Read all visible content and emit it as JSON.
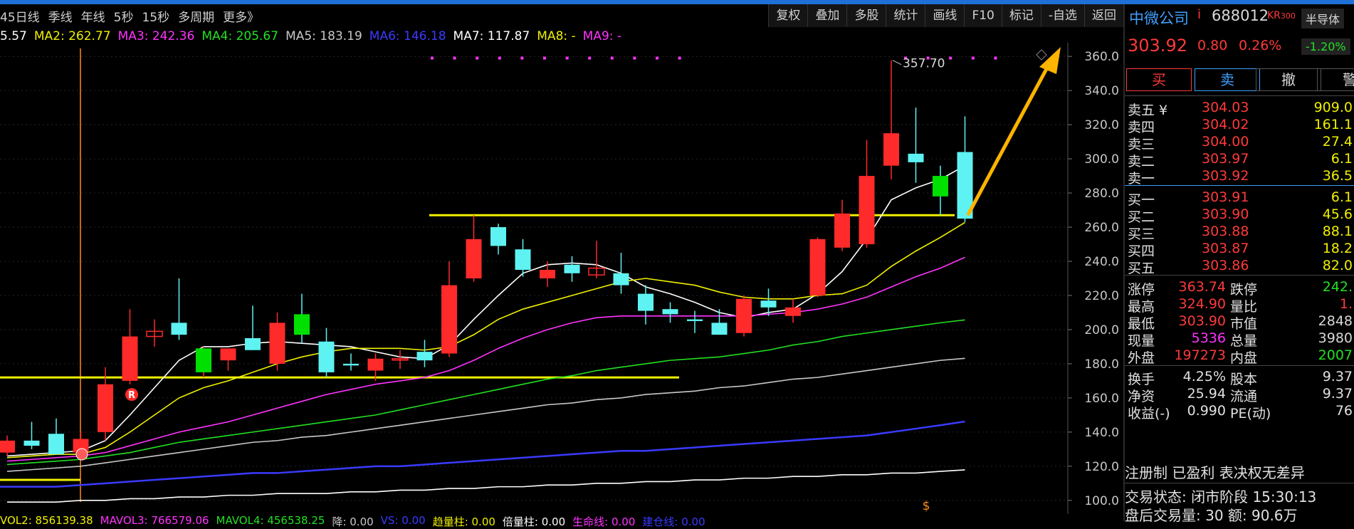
{
  "colors": {
    "up": "#ff2a2a",
    "down": "#00e000",
    "flat": "#ffffff",
    "accent": "#1e6fd6",
    "yellow": "#f0f000",
    "cyan": "#5ef2f2"
  },
  "period_bar": [
    "45日线",
    "季线",
    "年线",
    "5秒",
    "15秒",
    "多周期",
    "更多》"
  ],
  "toolbar": [
    "复权",
    "叠加",
    "多股",
    "统计",
    "画线",
    "F10",
    "标记",
    "-自选",
    "返回"
  ],
  "ma_legend": [
    {
      "label": "5.57",
      "color": "#ffffff"
    },
    {
      "label": "MA2: 262.77",
      "color": "#f0f000"
    },
    {
      "label": "MA3: 242.36",
      "color": "#ff33ff"
    },
    {
      "label": "MA4: 205.67",
      "color": "#22e022"
    },
    {
      "label": "MA5: 183.19",
      "color": "#c8c8c8"
    },
    {
      "label": "MA6: 146.18",
      "color": "#3a3aff"
    },
    {
      "label": "MA7: 117.87",
      "color": "#ffffff"
    },
    {
      "label": "MA8: -",
      "color": "#f0f000"
    },
    {
      "label": "MA9: -",
      "color": "#ff33ff"
    }
  ],
  "chart_data": {
    "type": "candlestick",
    "ylim": [
      92,
      368
    ],
    "y_ticks": [
      "360.0",
      "340.0",
      "320.0",
      "300.0",
      "280.0",
      "260.0",
      "240.0",
      "220.0",
      "200.0",
      "180.0",
      "160.0",
      "140.0",
      "120.0",
      "100.0"
    ],
    "candles": [
      {
        "o": 128,
        "h": 138,
        "l": 126,
        "c": 135
      },
      {
        "o": 135,
        "h": 146,
        "l": 130,
        "c": 132
      },
      {
        "o": 139,
        "h": 148,
        "l": 128,
        "c": 127
      },
      {
        "o": 128,
        "h": 140,
        "l": 127,
        "c": 136
      },
      {
        "o": 140,
        "h": 178,
        "l": 135,
        "c": 168
      },
      {
        "o": 170,
        "h": 212,
        "l": 168,
        "c": 196
      },
      {
        "o": 196,
        "h": 206,
        "l": 190,
        "c": 199
      },
      {
        "o": 204,
        "h": 230,
        "l": 194,
        "c": 197
      },
      {
        "o": 175,
        "h": 190,
        "l": 172,
        "c": 189
      },
      {
        "o": 182,
        "h": 189,
        "l": 176,
        "c": 189
      },
      {
        "o": 195,
        "h": 214,
        "l": 188,
        "c": 188
      },
      {
        "o": 180,
        "h": 210,
        "l": 176,
        "c": 204
      },
      {
        "o": 209,
        "h": 221,
        "l": 192,
        "c": 197
      },
      {
        "o": 193,
        "h": 201,
        "l": 172,
        "c": 175
      },
      {
        "o": 180,
        "h": 186,
        "l": 176,
        "c": 179
      },
      {
        "o": 176,
        "h": 186,
        "l": 170,
        "c": 183
      },
      {
        "o": 183,
        "h": 188,
        "l": 177,
        "c": 183
      },
      {
        "o": 187,
        "h": 194,
        "l": 178,
        "c": 182
      },
      {
        "o": 186,
        "h": 240,
        "l": 184,
        "c": 226
      },
      {
        "o": 230,
        "h": 267,
        "l": 228,
        "c": 253
      },
      {
        "o": 260,
        "h": 262,
        "l": 244,
        "c": 249
      },
      {
        "o": 247,
        "h": 253,
        "l": 231,
        "c": 235
      },
      {
        "o": 230,
        "h": 240,
        "l": 225,
        "c": 235
      },
      {
        "o": 238,
        "h": 243,
        "l": 228,
        "c": 233
      },
      {
        "o": 232,
        "h": 252,
        "l": 230,
        "c": 236
      },
      {
        "o": 233,
        "h": 245,
        "l": 221,
        "c": 226
      },
      {
        "o": 221,
        "h": 226,
        "l": 203,
        "c": 211
      },
      {
        "o": 212,
        "h": 216,
        "l": 204,
        "c": 209
      },
      {
        "o": 206,
        "h": 211,
        "l": 198,
        "c": 205
      },
      {
        "o": 204,
        "h": 212,
        "l": 197,
        "c": 197
      },
      {
        "o": 198,
        "h": 220,
        "l": 196,
        "c": 218
      },
      {
        "o": 217,
        "h": 224,
        "l": 208,
        "c": 213
      },
      {
        "o": 208,
        "h": 218,
        "l": 204,
        "c": 213
      },
      {
        "o": 220,
        "h": 254,
        "l": 219,
        "c": 253
      },
      {
        "o": 248,
        "h": 276,
        "l": 246,
        "c": 268
      },
      {
        "o": 250,
        "h": 311,
        "l": 248,
        "c": 290
      },
      {
        "o": 296,
        "h": 357.7,
        "l": 288,
        "c": 315
      },
      {
        "o": 303,
        "h": 330,
        "l": 286,
        "c": 298
      },
      {
        "o": 290,
        "h": 296,
        "l": 267,
        "c": 278
      },
      {
        "o": 304,
        "h": 324.9,
        "l": 263,
        "c": 265
      }
    ],
    "ma_lines": [
      {
        "name": "MA1",
        "color": "#ffffff",
        "values": [
          126,
          127,
          128,
          129,
          135,
          150,
          166,
          182,
          190,
          190,
          192,
          193,
          192,
          191,
          190,
          187,
          184,
          183,
          191,
          206,
          220,
          233,
          238,
          239,
          238,
          233,
          225,
          221,
          216,
          210,
          207,
          210,
          212,
          221,
          234,
          253,
          276,
          283,
          288,
          296
        ]
      },
      {
        "name": "MA2",
        "color": "#f0f000",
        "values": [
          125,
          126,
          127,
          127,
          131,
          140,
          150,
          160,
          166,
          170,
          175,
          180,
          184,
          187,
          189,
          189,
          189,
          188,
          190,
          197,
          206,
          212,
          216,
          220,
          224,
          228,
          230,
          228,
          226,
          222,
          219,
          218,
          218,
          220,
          221,
          226,
          237,
          246,
          254,
          262.77
        ]
      },
      {
        "name": "MA3",
        "color": "#ff33ff",
        "values": [
          123,
          124,
          125,
          126,
          128,
          132,
          136,
          140,
          143,
          146,
          150,
          154,
          158,
          162,
          165,
          168,
          170,
          172,
          176,
          182,
          189,
          195,
          200,
          204,
          207,
          208,
          208,
          208,
          208,
          208,
          208,
          209,
          210,
          212,
          215,
          219,
          225,
          231,
          236,
          242.36
        ]
      },
      {
        "name": "MA4",
        "color": "#22e022",
        "values": [
          121,
          122,
          123,
          124,
          126,
          128,
          131,
          134,
          136,
          138,
          140,
          142,
          144,
          146,
          148,
          150,
          153,
          156,
          159,
          162,
          165,
          168,
          171,
          173,
          176,
          178,
          180,
          182,
          183,
          184,
          186,
          188,
          191,
          193,
          196,
          198,
          200,
          202,
          204,
          205.67
        ]
      },
      {
        "name": "MA5",
        "color": "#c8c8c8",
        "values": [
          117,
          118,
          119,
          120,
          122,
          124,
          126,
          128,
          130,
          132,
          134,
          135,
          137,
          138,
          140,
          142,
          144,
          146,
          148,
          150,
          152,
          154,
          156,
          157,
          159,
          160,
          162,
          163,
          164,
          166,
          167,
          169,
          171,
          172,
          174,
          176,
          178,
          180,
          182,
          183.19
        ]
      },
      {
        "name": "MA6",
        "color": "#3a3aff",
        "values": [
          108,
          108,
          108,
          109,
          110,
          111,
          112,
          113,
          114,
          115,
          116,
          116,
          117,
          118,
          119,
          120,
          120,
          121,
          122,
          123,
          124,
          125,
          126,
          127,
          128,
          129,
          129,
          130,
          131,
          132,
          133,
          134,
          135,
          136,
          137,
          138,
          140,
          142,
          144,
          146.18
        ]
      },
      {
        "name": "MA7",
        "color": "#ffffff",
        "values": [
          99,
          99,
          99,
          100,
          100,
          101,
          101,
          102,
          102,
          103,
          103,
          104,
          104,
          104,
          105,
          105,
          106,
          106,
          107,
          107,
          108,
          108,
          109,
          109,
          110,
          110,
          111,
          111,
          112,
          112,
          113,
          113,
          114,
          114,
          115,
          115,
          116,
          116,
          117,
          117.87
        ]
      }
    ],
    "annotations": {
      "high_label": "357.70",
      "r_marker": "R",
      "s_marker": "$"
    }
  },
  "volume_legend": [
    {
      "label": "VOL2: 856139.38",
      "color": "#f0f000"
    },
    {
      "label": "MAVOL3: 766579.06",
      "color": "#ff33ff"
    },
    {
      "label": "MAVOL4: 456538.25",
      "color": "#22e022"
    },
    {
      "label": "降: 0.00",
      "color": "#c8c8c8"
    },
    {
      "label": "VS: 0.00",
      "color": "#3a3aff"
    },
    {
      "label": "趋量柱: 0.00",
      "color": "#f0f000"
    },
    {
      "label": "倍量柱: 0.00",
      "color": "#ffffff"
    },
    {
      "label": "生命线: 0.00",
      "color": "#ff33ff"
    },
    {
      "label": "建仓线: 0.00",
      "color": "#3a3aff"
    }
  ],
  "quote": {
    "name": "中微公司",
    "info_icon": "i",
    "code": "688012",
    "board": "KR",
    "board_index": "300",
    "sector": "半导体",
    "price": "303.92",
    "change": "0.80",
    "change_pct": "0.26%",
    "sector_pct": "-1.20%",
    "buttons": [
      "买",
      "卖",
      "撤",
      "警"
    ],
    "sell_levels": [
      {
        "label": "卖五 ¥",
        "price": "304.03",
        "vol": "909.0"
      },
      {
        "label": "卖四",
        "price": "304.02",
        "vol": "161.1"
      },
      {
        "label": "卖三",
        "price": "304.00",
        "vol": "27.4"
      },
      {
        "label": "卖二",
        "price": "303.97",
        "vol": "6.1"
      },
      {
        "label": "卖一",
        "price": "303.92",
        "vol": "36.5"
      }
    ],
    "buy_levels": [
      {
        "label": "买一",
        "price": "303.91",
        "vol": "6.1"
      },
      {
        "label": "买二",
        "price": "303.90",
        "vol": "45.6"
      },
      {
        "label": "买三",
        "price": "303.88",
        "vol": "88.1"
      },
      {
        "label": "买四",
        "price": "303.87",
        "vol": "18.2"
      },
      {
        "label": "买五",
        "price": "303.86",
        "vol": "82.0"
      }
    ],
    "stats": [
      {
        "l1": "涨停",
        "v1": "363.74",
        "c1": "#ff3a3a",
        "l2": "跌停",
        "v2": "242.",
        "c2": "#22e022"
      },
      {
        "l1": "最高",
        "v1": "324.90",
        "c1": "#ff3a3a",
        "l2": "量比",
        "v2": "1.",
        "c2": "#ff3a3a"
      },
      {
        "l1": "最低",
        "v1": "303.90",
        "c1": "#ff3a3a",
        "l2": "市值",
        "v2": "2848",
        "c2": "#d8d8d8"
      },
      {
        "l1": "现量",
        "v1": "5336",
        "c1": "#ff33ff",
        "l2": "总量",
        "v2": "3980",
        "c2": "#d8d8d8"
      },
      {
        "l1": "外盘",
        "v1": "197273",
        "c1": "#ff3a3a",
        "l2": "内盘",
        "v2": "2007",
        "c2": "#22e022"
      }
    ],
    "stats2": [
      {
        "l1": "换手",
        "v1": "4.25%",
        "l2": "股本",
        "v2": "9.37"
      },
      {
        "l1": "净资",
        "v1": "25.94",
        "l2": "流通",
        "v2": "9.37"
      },
      {
        "l1": "收益(-)",
        "v1": "0.990",
        "l2": "PE(动)",
        "v2": "76"
      }
    ],
    "reg_line": "注册制 已盈利 表决权无差异",
    "status_line": "交易状态: 闭市阶段 15:30:13",
    "after_line": "盘后交易量: 30  额: 90.6万"
  }
}
